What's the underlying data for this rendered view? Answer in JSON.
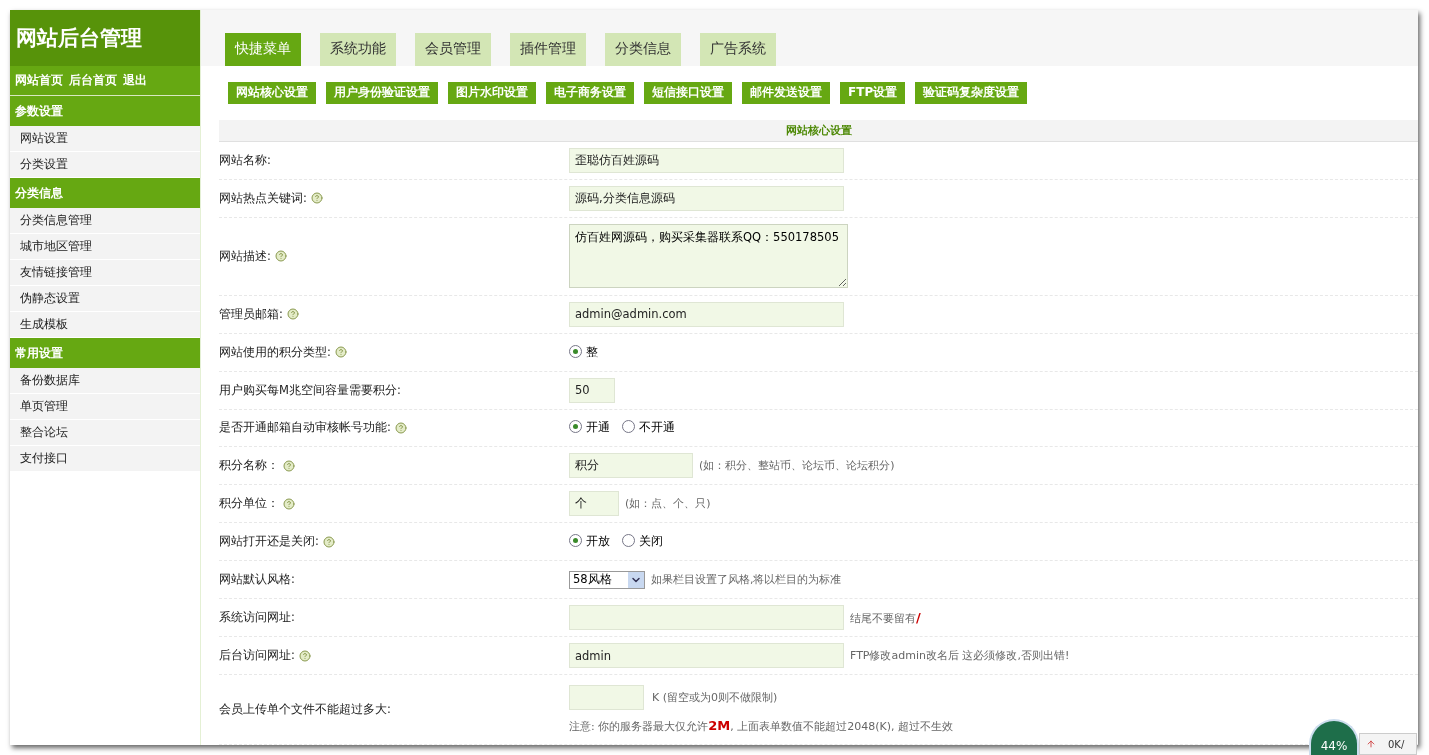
{
  "sidebar": {
    "title": "网站后台管理",
    "links": [
      "网站首页",
      "后台首页",
      "退出"
    ],
    "groups": [
      {
        "title": "参数设置",
        "items": [
          "网站设置",
          "分类设置"
        ]
      },
      {
        "title": "分类信息",
        "items": [
          "分类信息管理",
          "城市地区管理",
          "友情链接管理",
          "伪静态设置",
          "生成模板"
        ]
      },
      {
        "title": "常用设置",
        "items": [
          "备份数据库",
          "单页管理",
          "整合论坛",
          "支付接口"
        ]
      }
    ]
  },
  "tabs": [
    {
      "label": "快捷菜单",
      "selected": true
    },
    {
      "label": "系统功能",
      "selected": false
    },
    {
      "label": "会员管理",
      "selected": false
    },
    {
      "label": "插件管理",
      "selected": false
    },
    {
      "label": "分类信息",
      "selected": false
    },
    {
      "label": "广告系统",
      "selected": false
    }
  ],
  "sub_menu": [
    "网站核心设置",
    "用户身份验证设置",
    "图片水印设置",
    "电子商务设置",
    "短信接口设置",
    "邮件发送设置",
    "FTP设置",
    "验证码复杂度设置"
  ],
  "section_title": "网站核心设置",
  "rows": [
    {
      "label": "网站名称:",
      "help": false,
      "kind": "text",
      "value": "歪聪仿百姓源码"
    },
    {
      "label": "网站热点关键词:",
      "help": true,
      "kind": "text",
      "value": "源码,分类信息源码"
    },
    {
      "label": "网站描述:",
      "help": true,
      "kind": "textarea",
      "value": "仿百姓网源码，购买采集器联系QQ：550178505"
    },
    {
      "label": "管理员邮箱:",
      "help": true,
      "kind": "text",
      "value": "admin@admin.com"
    },
    {
      "label": "网站使用的积分类型:",
      "help": true,
      "kind": "radio",
      "options": [
        {
          "label": "整",
          "selected": true
        }
      ]
    },
    {
      "label": "用户购买每M兆空间容量需要积分:",
      "help": false,
      "kind": "short_text",
      "value": "50"
    },
    {
      "label": "是否开通邮箱自动审核帐号功能:",
      "help": true,
      "kind": "radio",
      "options": [
        {
          "label": "开通",
          "selected": true
        },
        {
          "label": "不开通",
          "selected": false
        }
      ]
    },
    {
      "label": "积分名称：",
      "help": true,
      "kind": "medium_text",
      "value": "积分",
      "hint": "(如：积分、整站币、论坛币、论坛积分)"
    },
    {
      "label": "积分单位：",
      "help": true,
      "kind": "tiny_text",
      "value": "个",
      "hint": "(如：点、个、只)"
    },
    {
      "label": "网站打开还是关闭:",
      "help": true,
      "kind": "radio",
      "options": [
        {
          "label": "开放",
          "selected": true
        },
        {
          "label": "关闭",
          "selected": false
        }
      ]
    },
    {
      "label": "网站默认风格:",
      "help": false,
      "kind": "select",
      "value": "58风格",
      "hint": "如果栏目设置了风格,将以栏目的为标准"
    },
    {
      "label": "系统访问网址:",
      "help": false,
      "kind": "text",
      "value": "",
      "hint": "结尾不要留有**/**"
    },
    {
      "label": "后台访问网址:",
      "help": true,
      "kind": "text",
      "value": "admin",
      "hint": "FTP修改admin改名后 这必须修改,否则出错!"
    },
    {
      "label": "会员上传单个文件不能超过多大:",
      "help": false,
      "kind": "upload",
      "value": "",
      "hint": "K (留空或为0则不做限制)",
      "note": "注意: 你的服务器最大仅允许**2M**, 上面表单数值不能超过2048(K), 超过不生效"
    }
  ],
  "speed_widget": {
    "percent": "44%",
    "rate": "0K/"
  }
}
